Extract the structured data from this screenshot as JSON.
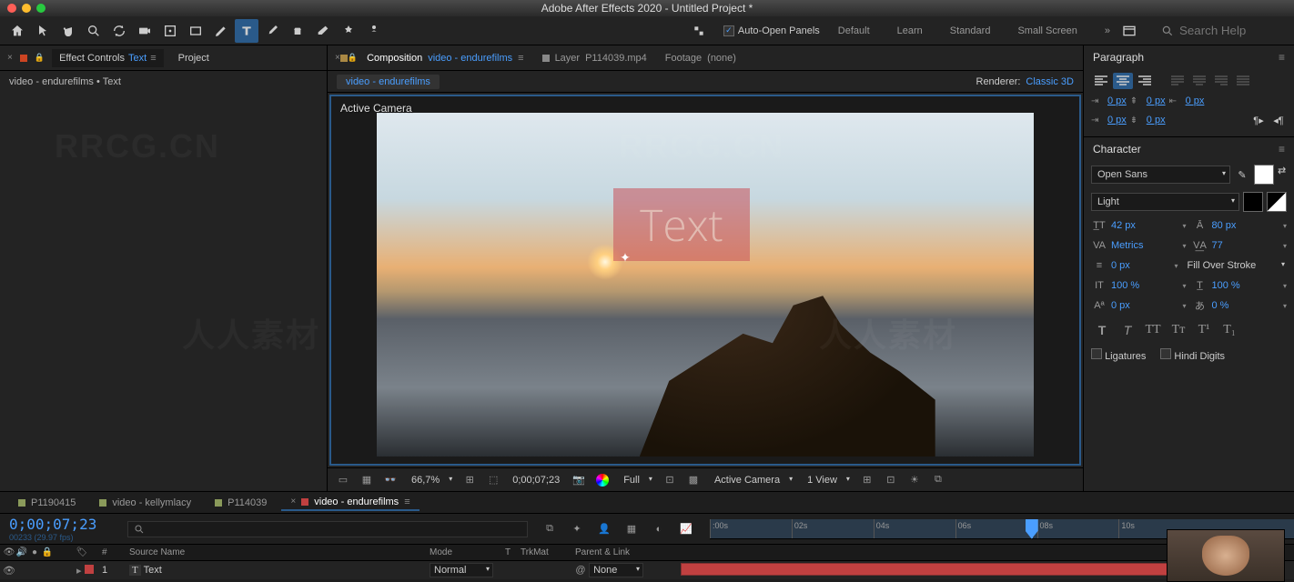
{
  "window": {
    "title": "Adobe After Effects 2020 - Untitled Project *"
  },
  "toolbar": {
    "auto_open_label": "Auto-Open Panels",
    "workspaces": [
      "Default",
      "Learn",
      "Standard",
      "Small Screen"
    ],
    "search_placeholder": "Search Help"
  },
  "left_panel": {
    "tabs": {
      "effect_controls": "Effect Controls",
      "text": "Text",
      "project": "Project"
    },
    "breadcrumb": {
      "comp": "video - endurefilms",
      "layer": "Text"
    }
  },
  "center_panel": {
    "tabs": {
      "composition": "Composition",
      "comp_name": "video - endurefilms",
      "layer": "Layer",
      "layer_name": "P114039.mp4",
      "footage": "Footage",
      "footage_name": "(none)"
    },
    "breadcrumb_comp": "video - endurefilms",
    "renderer_label": "Renderer:",
    "renderer_value": "Classic 3D",
    "viewer_label": "Active Camera",
    "text_overlay": "Text",
    "footer": {
      "zoom": "66,7%",
      "timecode": "0;00;07;23",
      "resolution": "Full",
      "camera": "Active Camera",
      "views": "1 View"
    }
  },
  "paragraph": {
    "title": "Paragraph",
    "indent_left": "0 px",
    "indent_right": "0 px",
    "indent_first": "0 px",
    "space_before": "0 px",
    "space_after": "0 px"
  },
  "character": {
    "title": "Character",
    "font_family": "Open Sans",
    "font_style": "Light",
    "font_size": "42 px",
    "leading": "80 px",
    "kerning": "Metrics",
    "tracking": "77",
    "stroke_width": "0 px",
    "fill_stroke": "Fill Over Stroke",
    "vert_scale": "100 %",
    "horiz_scale": "100 %",
    "baseline": "0 px",
    "tsume": "0 %",
    "ligatures": "Ligatures",
    "hindi": "Hindi Digits"
  },
  "timeline": {
    "tabs": [
      {
        "name": "P1190415",
        "color": "#8a9a5a"
      },
      {
        "name": "video - kellymlacy",
        "color": "#8a9a5a"
      },
      {
        "name": "P114039",
        "color": "#8a9a5a"
      },
      {
        "name": "video - endurefilms",
        "color": "#c04040",
        "active": true
      }
    ],
    "timecode": "0;00;07;23",
    "frameinfo": "00233 (29.97 fps)",
    "headers": {
      "num": "#",
      "source": "Source Name",
      "mode": "Mode",
      "t": "T",
      "trkmat": "TrkMat",
      "parent": "Parent & Link"
    },
    "ruler": [
      ":00s",
      "02s",
      "04s",
      "06s",
      "08s",
      "10s"
    ],
    "layer": {
      "num": "1",
      "name": "Text",
      "mode": "Normal",
      "parent": "None"
    }
  }
}
